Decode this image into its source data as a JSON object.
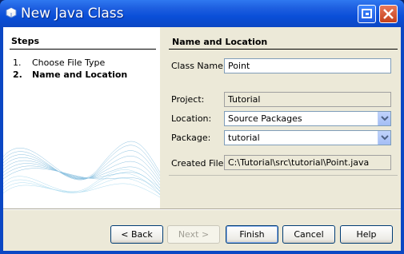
{
  "window": {
    "title": "New Java Class"
  },
  "steps": {
    "heading": "Steps",
    "items": [
      {
        "num": "1.",
        "label": "Choose File Type"
      },
      {
        "num": "2.",
        "label": "Name and Location"
      }
    ]
  },
  "form": {
    "heading": "Name and Location",
    "class_name_label": "Class Name:",
    "class_name_value": "Point",
    "project_label": "Project:",
    "project_value": "Tutorial",
    "location_label": "Location:",
    "location_value": "Source Packages",
    "package_label": "Package:",
    "package_value": "tutorial",
    "created_file_label": "Created File:",
    "created_file_value": "C:\\Tutorial\\src\\tutorial\\Point.java"
  },
  "buttons": {
    "back": "< Back",
    "next": "Next >",
    "finish": "Finish",
    "cancel": "Cancel",
    "help": "Help"
  },
  "colors": {
    "titlebar": "#0b47c4",
    "dialog_bg": "#ece9d8"
  }
}
